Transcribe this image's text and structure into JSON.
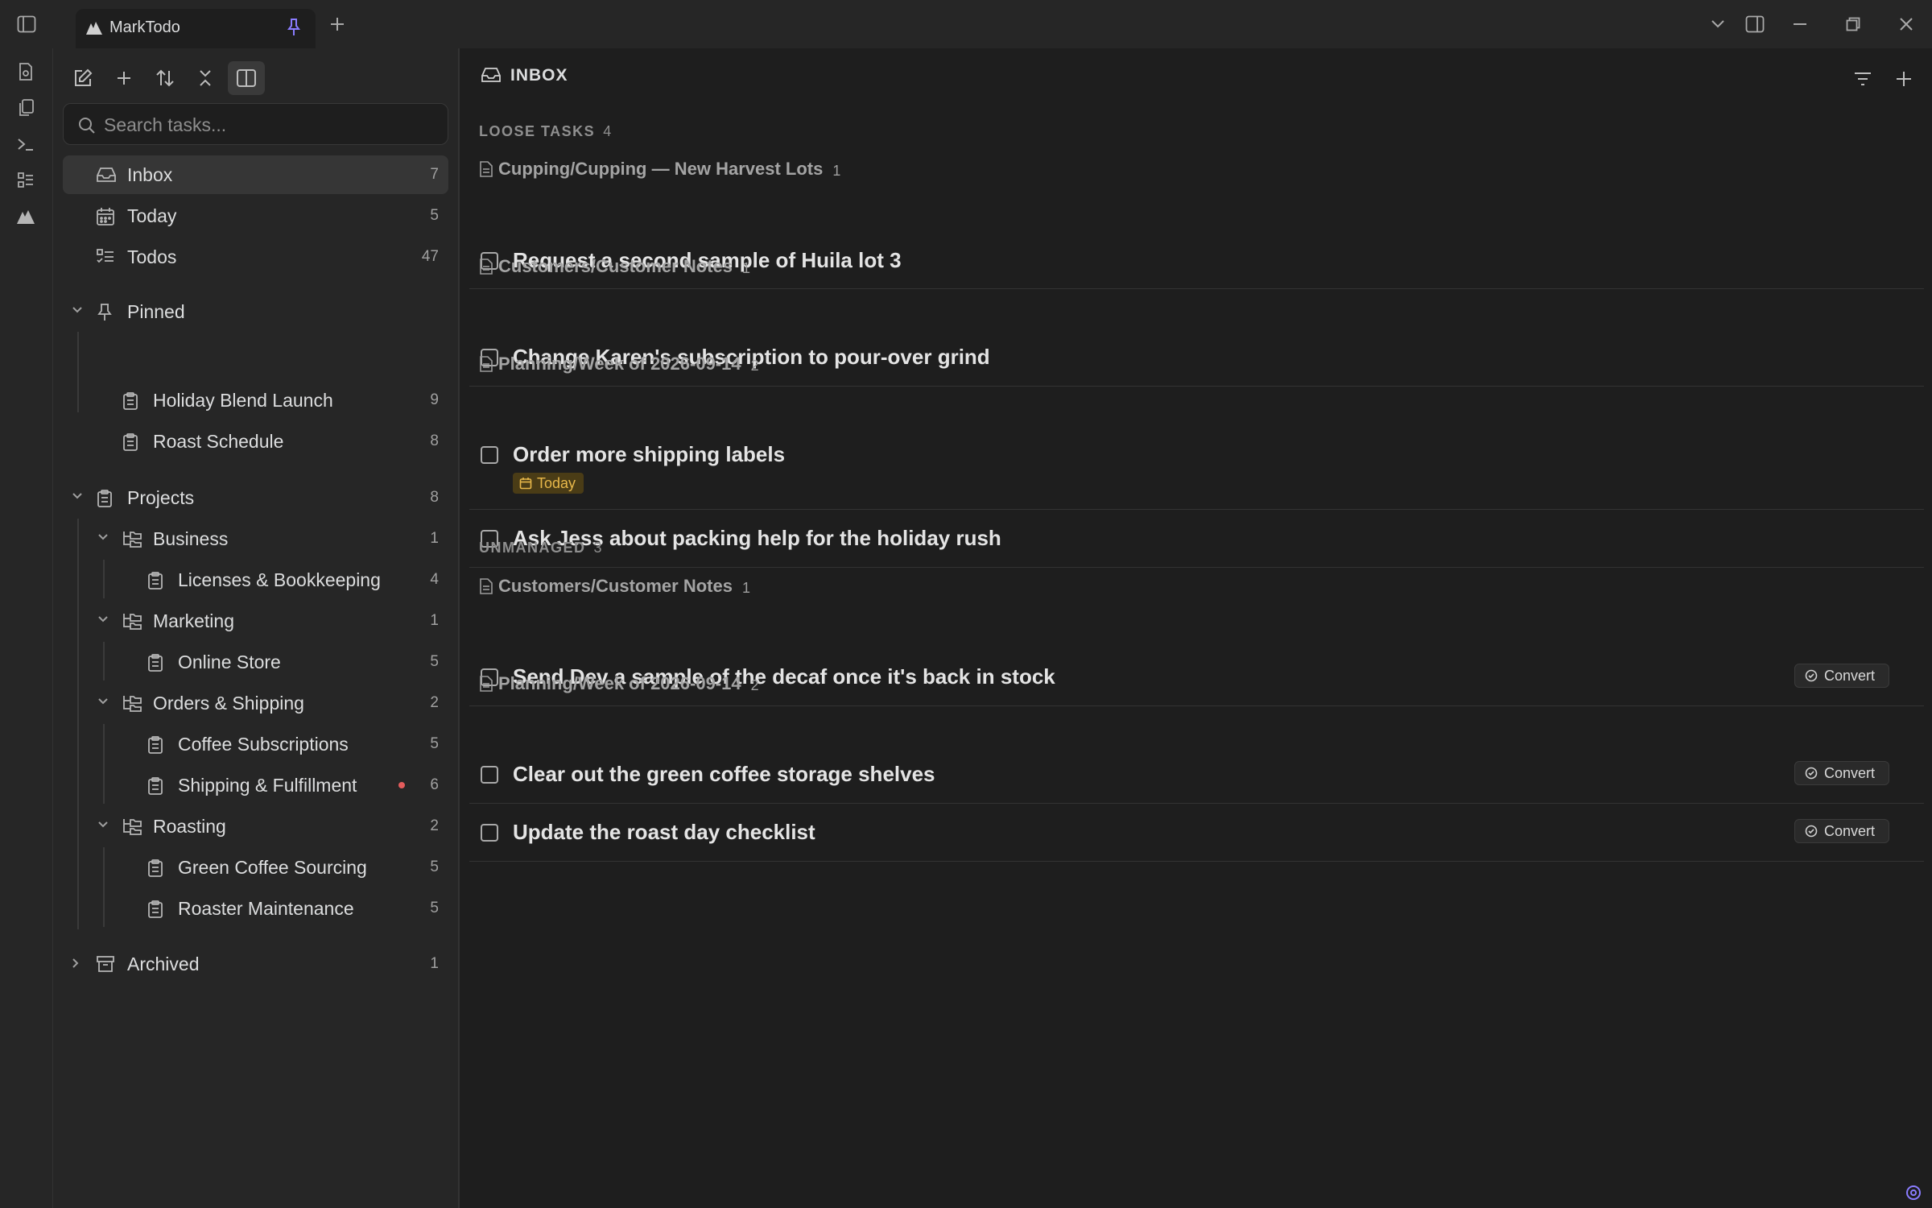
{
  "app": {
    "title": "MarkTodo"
  },
  "sidebar": {
    "search_placeholder": "Search tasks...",
    "views": [
      {
        "label": "Inbox",
        "count": "7",
        "icon": "inbox-icon"
      },
      {
        "label": "Today",
        "count": "5",
        "icon": "calendar-icon"
      },
      {
        "label": "Todos",
        "count": "47",
        "icon": "list-todo-icon"
      }
    ],
    "pinned": {
      "label": "Pinned",
      "items": [
        {
          "label": "Holiday Blend Launch",
          "count": "9"
        },
        {
          "label": "Roast Schedule",
          "count": "8"
        }
      ]
    },
    "projects": {
      "label": "Projects",
      "count": "8",
      "groups": [
        {
          "label": "Business",
          "count": "1",
          "items": [
            {
              "label": "Licenses & Bookkeeping",
              "count": "4"
            }
          ]
        },
        {
          "label": "Marketing",
          "count": "1",
          "items": [
            {
              "label": "Online Store",
              "count": "5"
            }
          ]
        },
        {
          "label": "Orders & Shipping",
          "count": "2",
          "items": [
            {
              "label": "Coffee Subscriptions",
              "count": "5"
            },
            {
              "label": "Shipping & Fulfillment",
              "count": "6"
            }
          ]
        },
        {
          "label": "Roasting",
          "count": "2",
          "items": [
            {
              "label": "Green Coffee Sourcing",
              "count": "5"
            },
            {
              "label": "Roaster Maintenance",
              "count": "5"
            }
          ]
        }
      ]
    },
    "archived": {
      "label": "Archived",
      "count": "1"
    }
  },
  "main": {
    "title": "INBOX",
    "loose": {
      "label": "LOOSE TASKS",
      "count": "4",
      "files": [
        {
          "name": "Cupping/Cupping — New Harvest Lots",
          "count": "1",
          "tasks": [
            "Request a second sample of Huila lot 3"
          ]
        },
        {
          "name": "Customers/Customer Notes",
          "count": "1",
          "tasks": [
            "Change Karen's subscription to pour-over grind"
          ]
        },
        {
          "name": "Planning/Week of 2026-09-14",
          "count": "2",
          "tasks": [
            "Order more shipping labels",
            "Ask Jess about packing help for the holiday rush"
          ],
          "badge": "Today"
        }
      ]
    },
    "unmanaged": {
      "label": "UNMANAGED",
      "count": "3",
      "convert_label": "Convert",
      "files": [
        {
          "name": "Customers/Customer Notes",
          "count": "1",
          "tasks": [
            "Send Dev a sample of the decaf once it's back in stock"
          ]
        },
        {
          "name": "Planning/Week of 2026-09-14",
          "count": "2",
          "tasks": [
            "Clear out the green coffee storage shelves",
            "Update the roast day checklist"
          ]
        }
      ]
    }
  },
  "colors": {
    "accent": "#8a7cff",
    "today_badge_bg": "#4a3c16",
    "today_badge_fg": "#e8b84a",
    "alert_dot": "#e35c5c"
  }
}
